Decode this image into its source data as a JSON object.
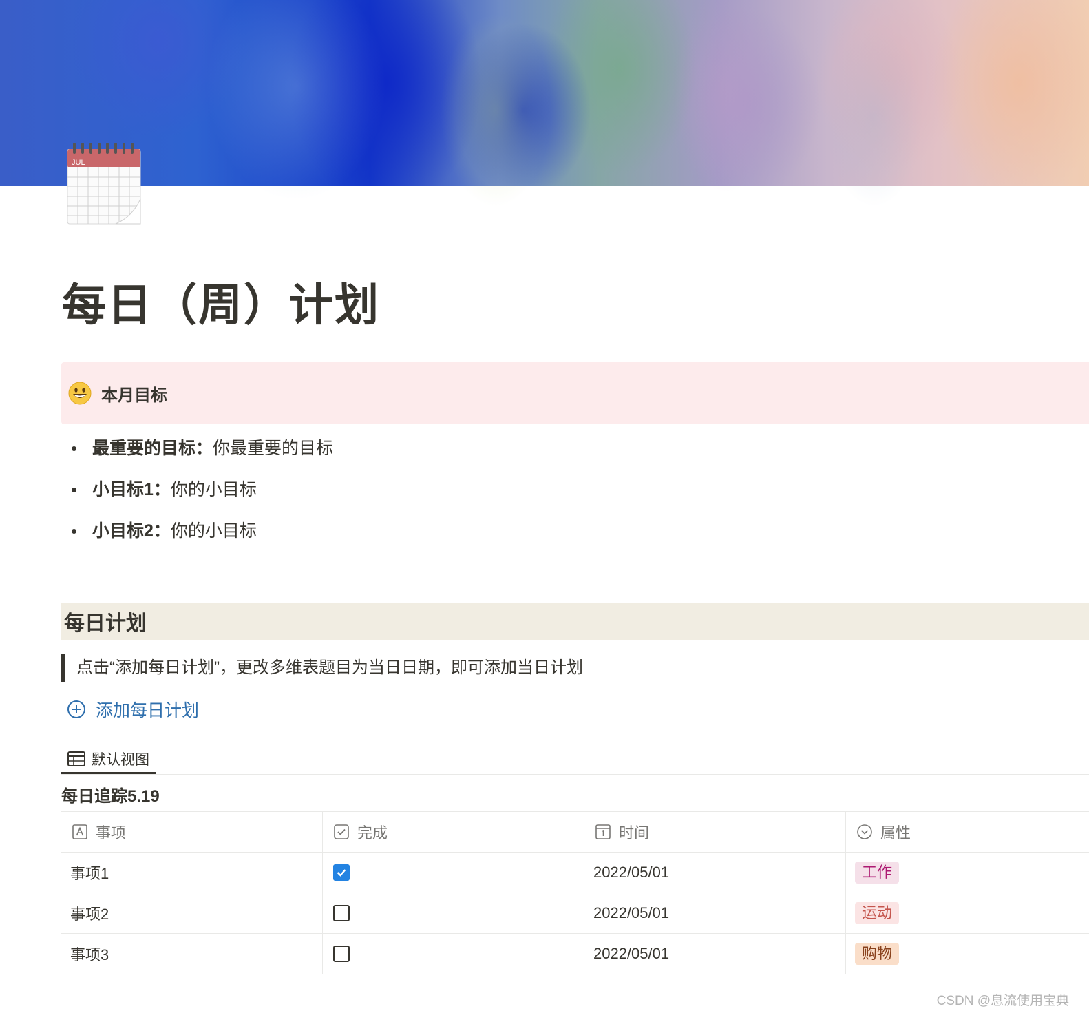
{
  "page": {
    "title": "每日（周）计划",
    "icon": "calendar-icon",
    "icon_month": "JUL"
  },
  "callout": {
    "emoji": "grinning-face-icon",
    "text": "本月目标"
  },
  "goals": [
    {
      "label": "最重要的目标：",
      "value": "你最重要的目标"
    },
    {
      "label": "小目标1：",
      "value": "你的小目标"
    },
    {
      "label": "小目标2：",
      "value": "你的小目标"
    }
  ],
  "daily_plan": {
    "heading": "每日计划",
    "quote": "点击“添加每日计划”，更改多维表题目为当日日期，即可添加当日计划",
    "add_button": "添加每日计划",
    "view_tab": "默认视图",
    "database_title": "每日追踪5.19",
    "columns": [
      {
        "label": "事项",
        "icon": "text-property-icon"
      },
      {
        "label": "完成",
        "icon": "checkbox-property-icon"
      },
      {
        "label": "时间",
        "icon": "date-property-icon"
      },
      {
        "label": "属性",
        "icon": "select-property-icon"
      }
    ],
    "rows": [
      {
        "item": "事项1",
        "done": true,
        "date": "2022/05/01",
        "tag": "工作"
      },
      {
        "item": "事项2",
        "done": false,
        "date": "2022/05/01",
        "tag": "运动"
      },
      {
        "item": "事项3",
        "done": false,
        "date": "2022/05/01",
        "tag": "购物"
      }
    ],
    "tag_colors": {
      "工作": {
        "bg": "#f5e0e9",
        "fg": "#ad1a72"
      },
      "运动": {
        "bg": "#fbe4e4",
        "fg": "#c4554d"
      },
      "购物": {
        "bg": "#fadec9",
        "fg": "#89421d"
      }
    }
  },
  "colors": {
    "callout_bg": "#fdebec",
    "heading_bg": "#f1ede2",
    "link": "#2f6fad",
    "checkbox_checked": "#2383e2"
  },
  "watermark": "CSDN @息流使用宝典"
}
